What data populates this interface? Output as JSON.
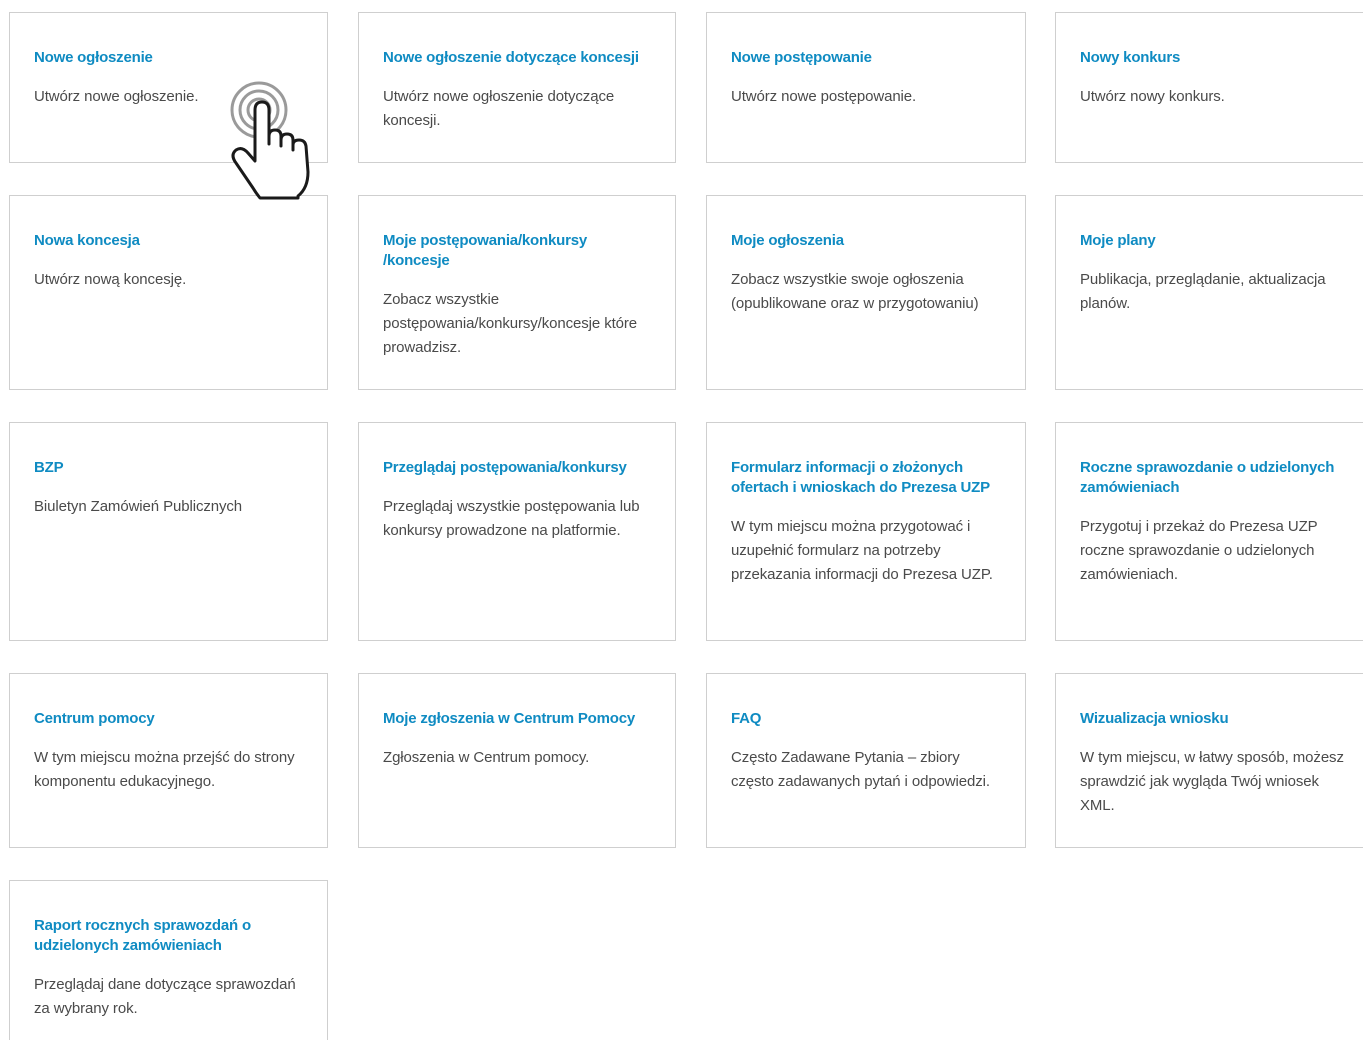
{
  "tiles": [
    {
      "title": "Nowe ogłoszenie",
      "desc": "Utwórz nowe ogłoszenie."
    },
    {
      "title": "Nowe ogłoszenie dotyczące koncesji",
      "desc": "Utwórz nowe ogłoszenie dotyczące koncesji."
    },
    {
      "title": "Nowe postępowanie",
      "desc": "Utwórz nowe postępowanie."
    },
    {
      "title": "Nowy konkurs",
      "desc": "Utwórz nowy konkurs."
    },
    {
      "title": "Nowa koncesja",
      "desc": "Utwórz nową koncesję."
    },
    {
      "title": "Moje postępowania/konkursy /koncesje",
      "desc": "Zobacz wszystkie postępowania/konkursy/koncesje które prowadzisz."
    },
    {
      "title": "Moje ogłoszenia",
      "desc": "Zobacz wszystkie swoje ogłoszenia (opublikowane oraz w przygotowaniu)"
    },
    {
      "title": "Moje plany",
      "desc": "Publikacja, przeglądanie, aktualizacja planów."
    },
    {
      "title": "BZP",
      "desc": "Biuletyn Zamówień Publicznych"
    },
    {
      "title": "Przeglądaj postępowania/konkursy",
      "desc": "Przeglądaj wszystkie postępowania lub konkursy prowadzone na platformie."
    },
    {
      "title": "Formularz informacji o złożonych ofertach i wnioskach do Prezesa UZP",
      "desc": "W tym miejscu można przygotować i uzupełnić formularz na potrzeby przekazania informacji do Prezesa UZP."
    },
    {
      "title": "Roczne sprawozdanie o udzielonych zamówieniach",
      "desc": "Przygotuj i przekaż do Prezesa UZP roczne sprawozdanie o udzielonych zamówieniach."
    },
    {
      "title": "Centrum pomocy",
      "desc": "W tym miejscu można przejść do strony komponentu edukacyjnego."
    },
    {
      "title": "Moje zgłoszenia w Centrum Pomocy",
      "desc": "Zgłoszenia w Centrum pomocy."
    },
    {
      "title": "FAQ",
      "desc": "Często Zadawane Pytania – zbiory często zadawanych pytań i odpowiedzi."
    },
    {
      "title": "Wizualizacja wniosku",
      "desc": "W tym miejscu, w łatwy sposób, możesz sprawdzić jak wygląda Twój wniosek XML."
    },
    {
      "title": "Raport rocznych sprawozdań o udzielonych zamówieniach",
      "desc": "Przeglądaj dane dotyczące sprawozdań za wybrany rok."
    }
  ],
  "colors": {
    "title": "#0f8bc2",
    "text": "#4a4a4a",
    "border": "#cfcfcf"
  },
  "overlay": {
    "icon": "pointer-hand-tap-icon"
  }
}
